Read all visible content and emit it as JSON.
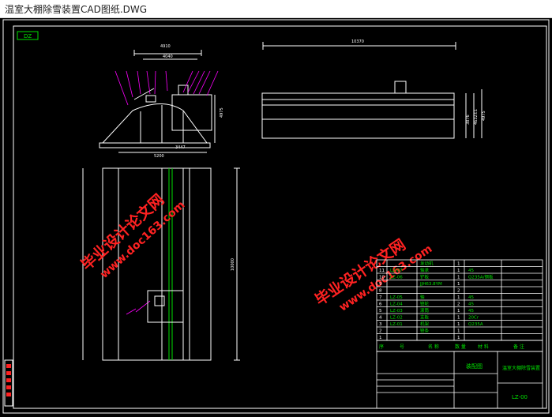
{
  "window": {
    "title": "温室大棚除雪装置CAD图纸.DWG"
  },
  "colors": {
    "background": "#000000",
    "frame": "#ffffff",
    "green": "#00e000",
    "magenta": "#ff00ff",
    "red": "#ff2020",
    "text": "#ffffff",
    "watermark": "#ff2222"
  },
  "drawing": {
    "corner_tag": "DZ",
    "dims_front": {
      "w1": "4910",
      "w2": "4040",
      "b1": "3447",
      "b2": "5200",
      "h": "4975"
    },
    "dims_top": {
      "w": "10370"
    },
    "dims_side": {
      "h1": "3876",
      "h2": "4632±1",
      "h3": "4975"
    },
    "dims_plan": {
      "h": "10000"
    },
    "watermark": {
      "line1": "毕业设计论文网",
      "line2": "www.doc163.com"
    },
    "bom_rows": [
      {
        "no": "",
        "code": "",
        "name": "发动机",
        "qty": "1",
        "mat": ""
      },
      {
        "no": "11",
        "code": "LZ-07",
        "name": "轴承",
        "qty": "1",
        "mat": "45"
      },
      {
        "no": "10",
        "code": "LZ-06",
        "name": "铲板",
        "qty": "1",
        "mat": "Q235A/钢板"
      },
      {
        "no": "9",
        "code": "",
        "name": "JJH63.8YM",
        "qty": "1",
        "mat": ""
      },
      {
        "no": "8",
        "code": "",
        "name": "",
        "qty": "2",
        "mat": ""
      },
      {
        "no": "7",
        "code": "LZ-05",
        "name": "轴",
        "qty": "1",
        "mat": "45"
      },
      {
        "no": "6",
        "code": "LZ-04",
        "name": "链轮",
        "qty": "2",
        "mat": "45"
      },
      {
        "no": "5",
        "code": "LZ-03",
        "name": "滚筒",
        "qty": "1",
        "mat": "45"
      },
      {
        "no": "4",
        "code": "LZ-02",
        "name": "支板",
        "qty": "1",
        "mat": "20Cr"
      },
      {
        "no": "3",
        "code": "LZ-01",
        "name": "机架",
        "qty": "1",
        "mat": "Q235A"
      },
      {
        "no": "2",
        "code": "",
        "name": "链条",
        "qty": "1",
        "mat": ""
      },
      {
        "no": "1",
        "code": "",
        "name": "",
        "qty": "1",
        "mat": ""
      }
    ],
    "bom_header": {
      "no": "序",
      "code": "号",
      "name": "名 称",
      "qty": "数 量",
      "mat": "材 料",
      "remark": "备 注"
    },
    "title_block": {
      "name": "装配图",
      "company": "温室大棚除雪装置",
      "drawing_no": "LZ-00"
    }
  }
}
